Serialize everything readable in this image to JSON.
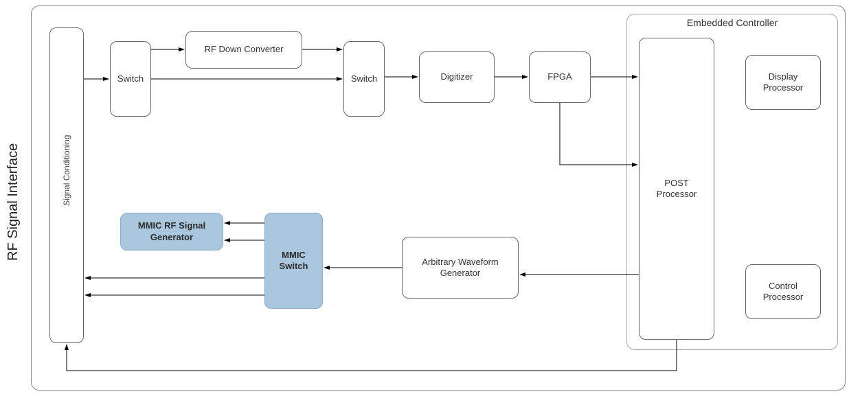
{
  "diagram": {
    "outer_label": "RF Signal Interface",
    "signal_conditioning_label": "Signal Conditioning",
    "switch1_label": "Switch",
    "switch2_label": "Switch",
    "rf_down_converter_label": "RF Down Converter",
    "digitizer_label": "Digitizer",
    "fpga_label": "FPGA",
    "embedded_controller_title": "Embedded Controller",
    "post_processor_label": "POST Processor",
    "display_processor_label": "Display Processor",
    "control_processor_label": "Control Processor",
    "mmic_rf_sig_gen_label": "MMIC RF Signal Generator",
    "mmic_switch_label": "MMIC Switch",
    "awg_label": "Arbitrary Waveform Generator"
  }
}
